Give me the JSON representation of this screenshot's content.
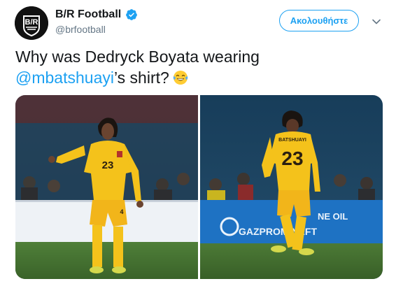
{
  "author": {
    "name": "B/R Football",
    "handle": "@brfootball",
    "avatar_text": "B/R"
  },
  "follow_button_label": "Ακολουθήστε",
  "tweet": {
    "text_line1": "Why was Dedryck Boyata wearing",
    "mention": "@mbatshuayi",
    "text_tail": "’s shirt?",
    "emoji": "face-with-tears-of-joy"
  },
  "media": {
    "photo_left": {
      "jersey_number": "23",
      "shorts_number": "4"
    },
    "photo_right": {
      "jersey_number": "23",
      "jersey_name": "BATSHUAYI",
      "ad_text": "GAZPROM NEFT",
      "ad_text_top": "NE OIL"
    }
  },
  "colors": {
    "accent": "#1da1f2",
    "text": "#14171a",
    "muted": "#657786",
    "kit_yellow": "#f4c21b"
  },
  "icons": [
    "verified-badge-icon",
    "chevron-down-icon"
  ]
}
